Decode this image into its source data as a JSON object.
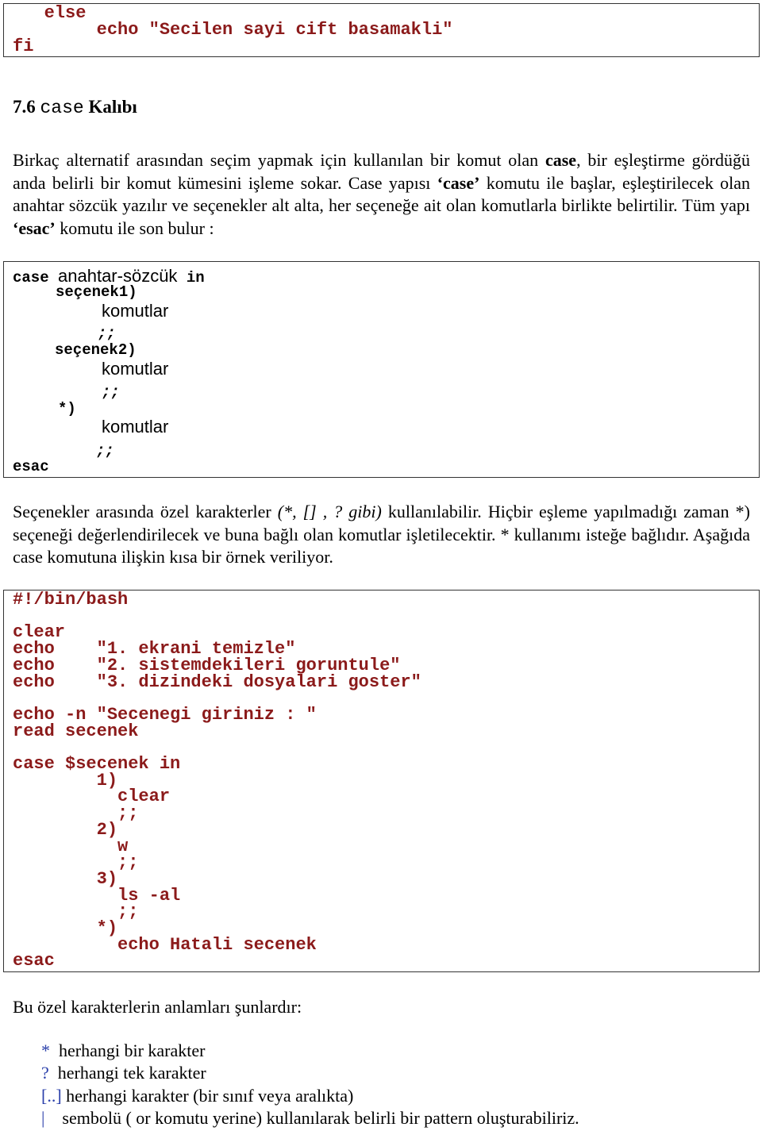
{
  "prev_code": {
    "lines": [
      "   else",
      "        echo \"Secilen sayi cift basamakli\"",
      "fi"
    ]
  },
  "heading": {
    "number": "7.6",
    "keyword": "case",
    "title": "Kalıbı"
  },
  "para1": {
    "t1": "Birkaç alternatif arasından seçim yapmak için kullanılan bir komut olan ",
    "b1": "case",
    "t2": ", bir eşleştirme gördüğü anda belirli bir komut kümesini işleme sokar. Case yapısı ",
    "b2": "‘case’",
    "t3": " komutu ile başlar, eşleştirilecek olan anahtar sözcük yazılır ve seçenekler alt alta, her seçeneğe ait olan komutlarla birlikte belirtilir. Tüm yapı ",
    "b3": "‘esac’",
    "t4": " komutu ile son bulur :"
  },
  "syntax": {
    "case": "case",
    "keyword": "anahtar-sözcük",
    "in": "in",
    "opt1": "seçenek1)",
    "opt2": "seçenek2)",
    "default": "*)",
    "commands": "komutlar",
    "terminator": ";;",
    "esac": "esac"
  },
  "para2": {
    "t1": "Seçenekler arasında özel karakterler ",
    "i1": "(*, [] , ? gibi)",
    "t2": " kullanılabilir. Hiçbir eşleme yapılmadığı zaman *) seçeneği değerlendirilecek ve buna bağlı olan komutlar işletilecektir. * kullanımı isteğe bağlıdır. Aşağıda case komutuna ilişkin kısa bir örnek veriliyor."
  },
  "script": {
    "lines": [
      "#!/bin/bash",
      "",
      "clear",
      "echo    \"1. ekrani temizle\"",
      "echo    \"2. sistemdekileri goruntule\"",
      "echo    \"3. dizindeki dosyalari goster\"",
      "",
      "echo -n \"Secenegi giriniz : \"",
      "read secenek",
      "",
      "case $secenek in",
      "        1)",
      "          clear",
      "          ;;",
      "        2)",
      "          w",
      "          ;;",
      "        3)",
      "          ls -al",
      "          ;;",
      "        *)",
      "          echo Hatali secenek",
      "esac"
    ]
  },
  "para3": "Bu özel karakterlerin anlamları şunlardır:",
  "special_chars": [
    {
      "symbol": "*",
      "desc": "  herhangi bir karakter"
    },
    {
      "symbol": "?",
      "desc": "  herhangi tek karakter"
    },
    {
      "symbol": "[..]",
      "desc": " herhangi karakter (bir sınıf veya aralıkta)"
    },
    {
      "symbol": "|",
      "desc": "    sembolü ( or komutu yerine) kullanılarak belirli bir pattern oluşturabiliriz."
    }
  ],
  "colors": {
    "code": "#8b1a1a",
    "symbol": "#2a3faa"
  }
}
